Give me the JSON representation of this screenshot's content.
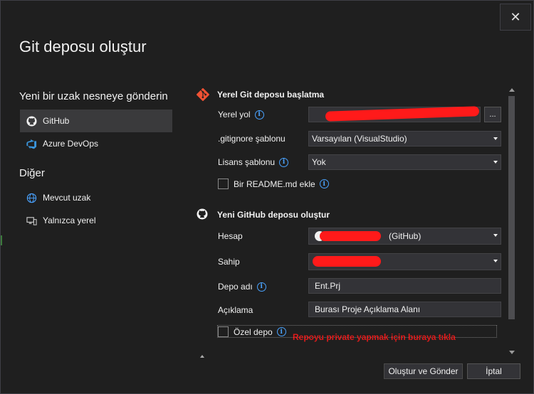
{
  "dialog": {
    "title": "Git deposu oluştur",
    "close_label": "✕"
  },
  "sidebar": {
    "section1_title": "Yeni bir uzak nesneye gönderin",
    "items": [
      {
        "label": "GitHub",
        "icon": "github-icon"
      },
      {
        "label": "Azure DevOps",
        "icon": "azure-devops-icon"
      }
    ],
    "section2_title": "Diğer",
    "other_items": [
      {
        "label": "Mevcut uzak",
        "icon": "globe-icon"
      },
      {
        "label": "Yalnızca yerel",
        "icon": "local-computer-icon"
      }
    ]
  },
  "local_repo": {
    "title": "Yerel Git deposu başlatma",
    "path_label": "Yerel yol",
    "browse_label": "...",
    "gitignore_label": ".gitignore şablonu",
    "gitignore_value": "Varsayılan (VisualStudio)",
    "license_label": "Lisans şablonu",
    "license_value": "Yok",
    "readme_label": "Bir README.md ekle"
  },
  "github_repo": {
    "title": "Yeni GitHub deposu oluştur",
    "account_label": "Hesap",
    "account_suffix": "(GitHub)",
    "owner_label": "Sahip",
    "repo_name_label": "Depo adı",
    "repo_name_value": "Ent.Prj",
    "description_label": "Açıklama",
    "description_value": "Burası Proje Açıklama Alanı",
    "private_label": "Özel depo",
    "annotation": "Repoyu private yapmak için buraya tıkla"
  },
  "footer": {
    "create_push_label": "Oluştur ve Gönder",
    "cancel_label": "İptal"
  },
  "colors": {
    "background": "#1f1f1f",
    "accent_blue": "#4aa3ff",
    "redaction": "#ff1a1a",
    "annotation_red": "#e01b1b"
  }
}
